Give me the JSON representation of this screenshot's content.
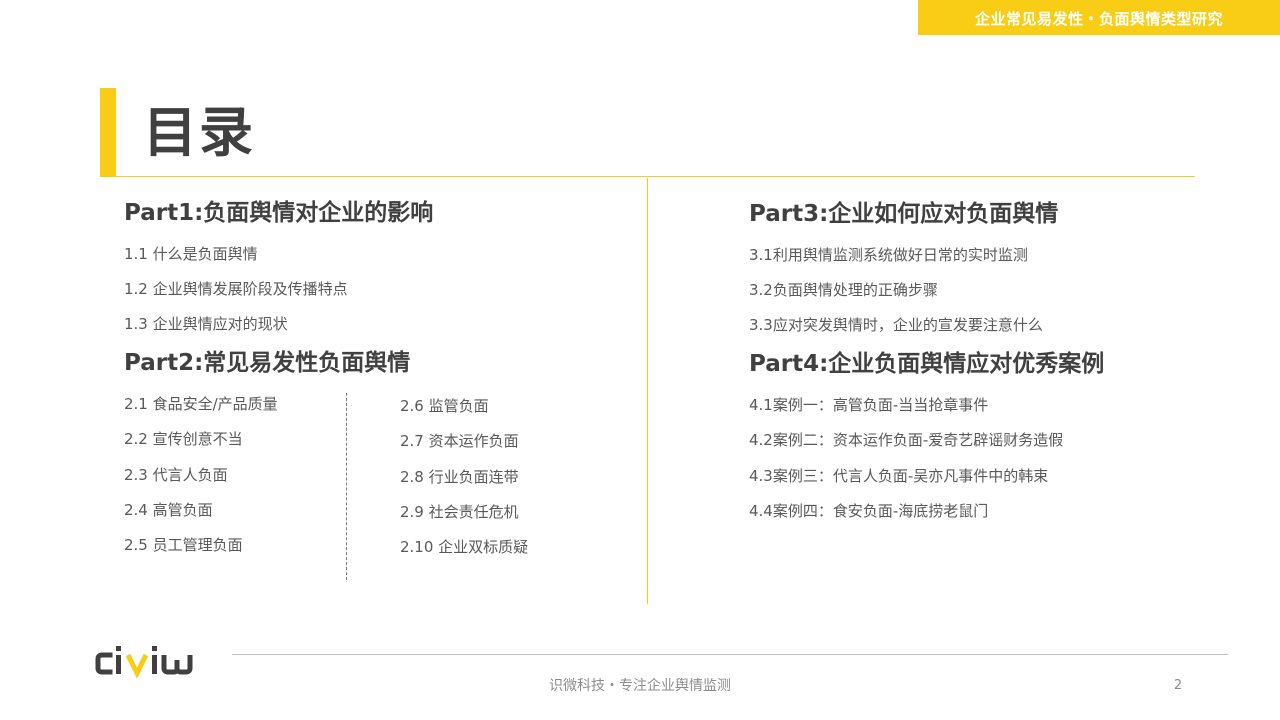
{
  "header": {
    "banner_text": "企业常见易发性・负面舆情类型研究"
  },
  "title": "目录",
  "colors": {
    "accent": "#f9cd16",
    "heading": "#404040",
    "body_text": "#595959",
    "footer_text": "#8c8c8c"
  },
  "part1": {
    "heading": "Part1:负面舆情对企业的影响",
    "items": [
      "1.1 什么是负面舆情",
      "1.2 企业舆情发展阶段及传播特点",
      "1.3 企业舆情应对的现状"
    ]
  },
  "part2": {
    "heading": "Part2:常见易发性负面舆情",
    "left_items": [
      "2.1 食品安全/产品质量",
      "2.2 宣传创意不当",
      "2.3 代言人负面",
      "2.4 高管负面",
      "2.5 员工管理负面"
    ],
    "right_items": [
      "2.6 监管负面",
      "2.7 资本运作负面",
      "2.8 行业负面连带",
      "2.9 社会责任危机",
      "2.10 企业双标质疑"
    ]
  },
  "part3": {
    "heading": "Part3:企业如何应对负面舆情",
    "items": [
      "3.1利用舆情监测系统做好日常的实时监测",
      "3.2负面舆情处理的正确步骤",
      "3.3应对突发舆情时，企业的宣发要注意什么"
    ]
  },
  "part4": {
    "heading": "Part4:企业负面舆情应对优秀案例",
    "items": [
      "4.1案例一：高管负面-当当抢章事件",
      "4.2案例二：资本运作负面-爱奇艺辟谣财务造假",
      "4.3案例三：代言人负面-吴亦凡事件中的韩束",
      "4.4案例四：食安负面-海底捞老鼠门"
    ]
  },
  "footer": {
    "logo_text": "civiw",
    "tagline": "识微科技・专注企业舆情监测",
    "page_number": "2"
  }
}
